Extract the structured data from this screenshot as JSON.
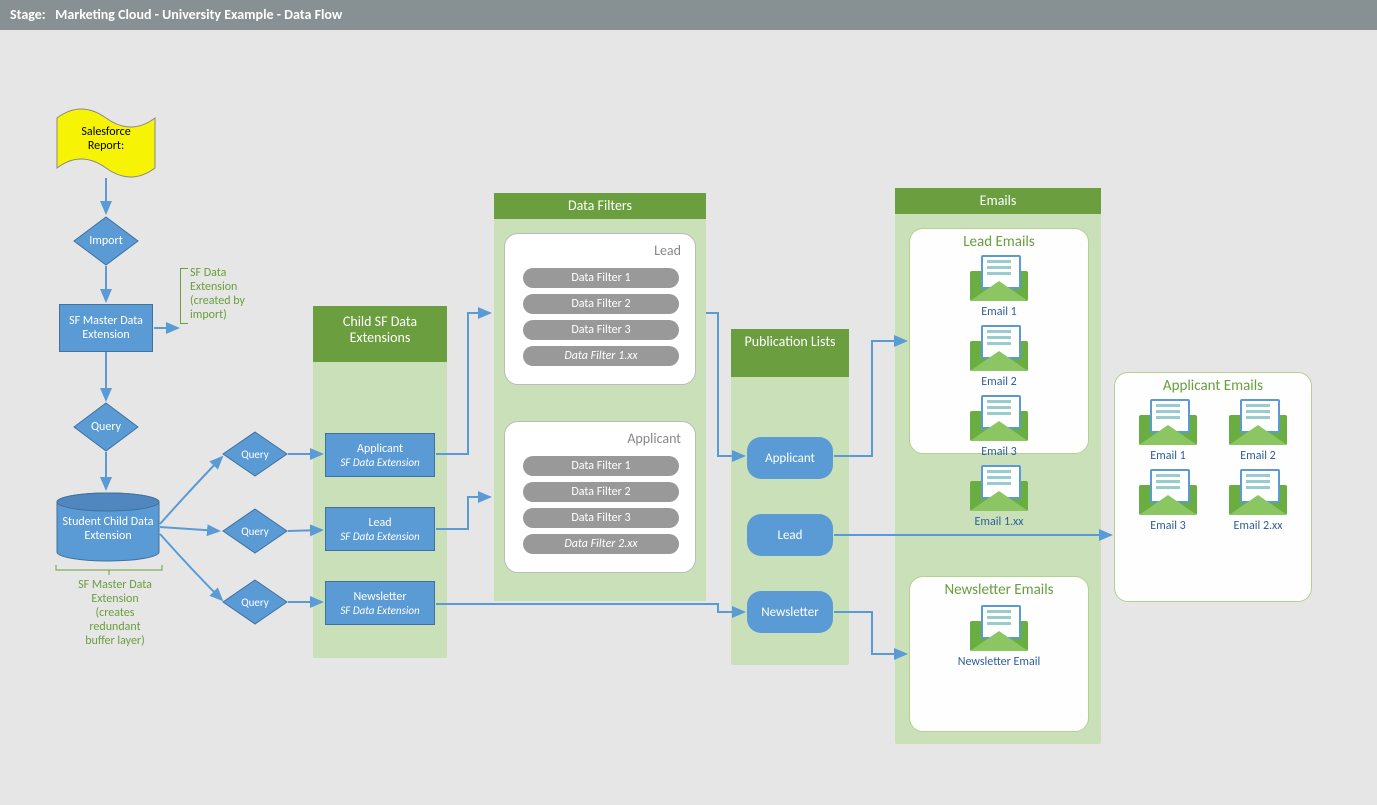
{
  "stage_label": "Stage:",
  "stage_title": "Marketing Cloud - University Example - Data Flow",
  "colors": {
    "blue": "#5b9bd5",
    "green": "#6a9e3e",
    "lightgreen": "#cae0b8",
    "gray": "#999",
    "yellow": "#f7f304"
  },
  "report": {
    "title": "Salesforce Report:"
  },
  "import": {
    "label": "Import"
  },
  "master": {
    "label": "SF Master Data Extension"
  },
  "master_note": "SF Data\nExtension\n(created by\nimport)",
  "cylinder": {
    "label": "Student Child Data Extension"
  },
  "cylinder_note": "SF Master Data\nExtension\n(creates\nredundant\nbuffer layer)",
  "query": {
    "label": "Query"
  },
  "child_panel": {
    "title": "Child SF Data Extensions",
    "items": [
      {
        "name": "Applicant",
        "sub": "SF Data Extension"
      },
      {
        "name": "Lead",
        "sub": "SF Data Extension"
      },
      {
        "name": "Newsletter",
        "sub": "SF Data Extension"
      }
    ]
  },
  "filter_panel": {
    "title": "Data Filters",
    "groups": [
      {
        "name": "Lead",
        "filters": [
          "Data Filter 1",
          "Data Filter 2",
          "Data Filter 3",
          "Data Filter 1.xx"
        ]
      },
      {
        "name": "Applicant",
        "filters": [
          "Data Filter 1",
          "Data Filter 2",
          "Data Filter 3",
          "Data Filter 2.xx"
        ]
      }
    ]
  },
  "pub_panel": {
    "title": "Publication Lists",
    "items": [
      "Applicant",
      "Lead",
      "Newsletter"
    ]
  },
  "emails_panel": {
    "title": "Emails",
    "lead": {
      "title": "Lead Emails",
      "items": [
        "Email 1",
        "Email 2",
        "Email 3",
        "Email 1.xx"
      ]
    },
    "applicant": {
      "title": "Applicant Emails",
      "items": [
        "Email 1",
        "Email 2",
        "Email 3",
        "Email 2.xx"
      ]
    },
    "newsletter": {
      "title": "Newsletter Emails",
      "items": [
        "Newsletter Email"
      ]
    }
  }
}
